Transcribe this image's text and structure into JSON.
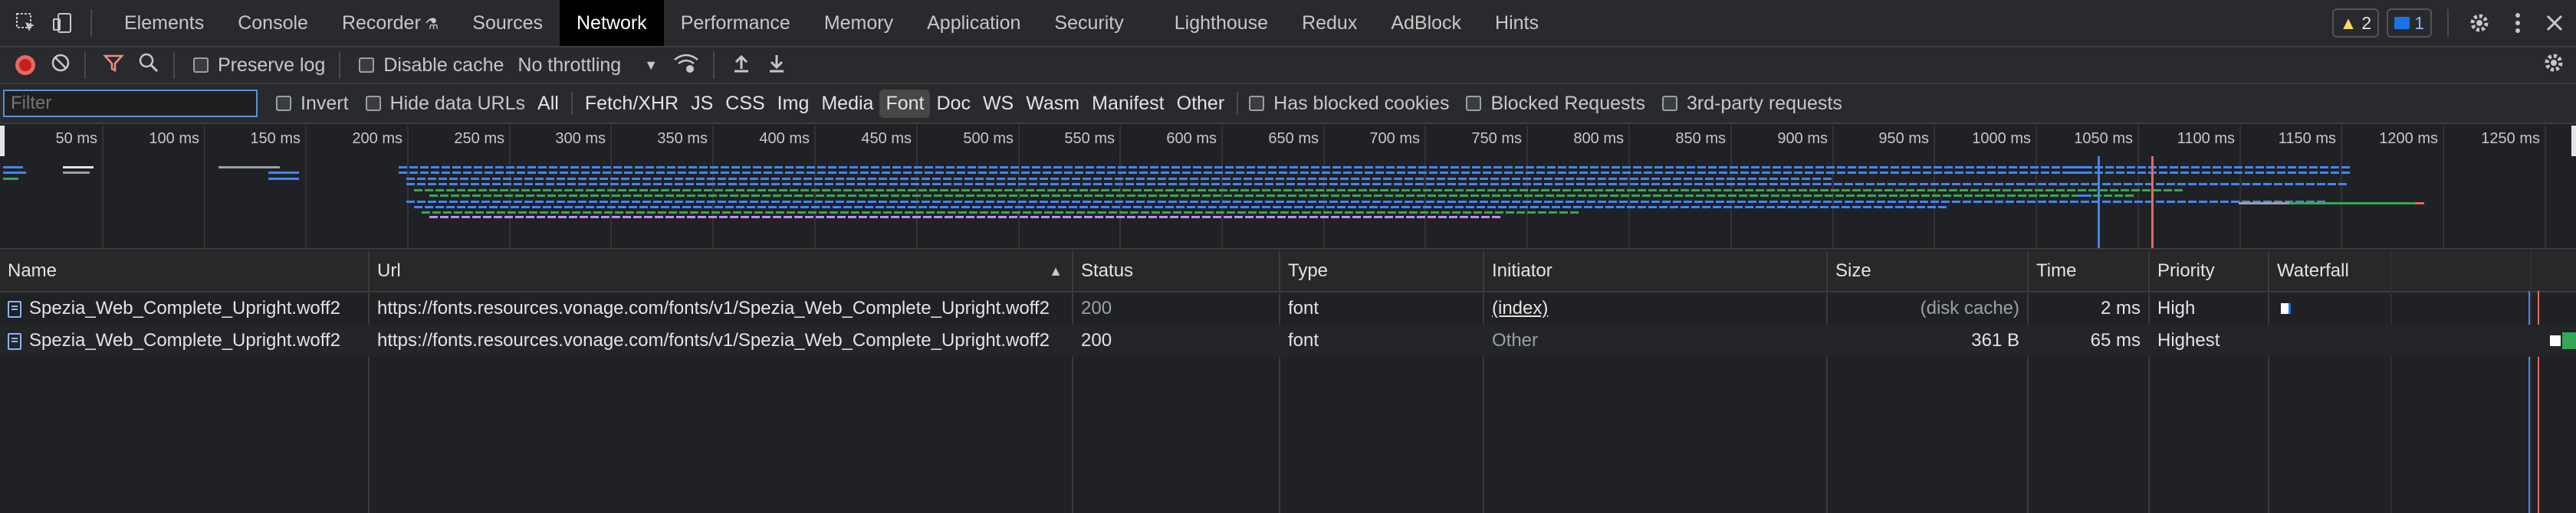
{
  "tabs": [
    "Elements",
    "Console",
    "Recorder",
    "Sources",
    "Network",
    "Performance",
    "Memory",
    "Application",
    "Security",
    "Lighthouse",
    "Redux",
    "AdBlock",
    "Hints"
  ],
  "active_tab": "Network",
  "badges": {
    "warnings": "2",
    "messages": "1"
  },
  "toolbar": {
    "preserve_log": "Preserve log",
    "disable_cache": "Disable cache",
    "throttling": "No throttling"
  },
  "filter": {
    "placeholder": "Filter",
    "invert": "Invert",
    "hide_data_urls": "Hide data URLs",
    "types": [
      "All",
      "Fetch/XHR",
      "JS",
      "CSS",
      "Img",
      "Media",
      "Font",
      "Doc",
      "WS",
      "Wasm",
      "Manifest",
      "Other"
    ],
    "active_type": "Font",
    "has_blocked_cookies": "Has blocked cookies",
    "blocked_requests": "Blocked Requests",
    "third_party": "3rd-party requests"
  },
  "overview_ticks": [
    "50 ms",
    "100 ms",
    "150 ms",
    "200 ms",
    "250 ms",
    "300 ms",
    "350 ms",
    "400 ms",
    "450 ms",
    "500 ms",
    "550 ms",
    "600 ms",
    "650 ms",
    "700 ms",
    "750 ms",
    "800 ms",
    "850 ms",
    "900 ms",
    "950 ms",
    "1000 ms",
    "1050 ms",
    "1100 ms",
    "1150 ms",
    "1200 ms",
    "1250 ms"
  ],
  "columns": [
    "Name",
    "Url",
    "Status",
    "Type",
    "Initiator",
    "Size",
    "Time",
    "Priority",
    "Waterfall"
  ],
  "rows": [
    {
      "name": "Spezia_Web_Complete_Upright.woff2",
      "url": "https://fonts.resources.vonage.com/fonts/v1/Spezia_Web_Complete_Upright.woff2",
      "status": "200",
      "type": "font",
      "initiator": "(index)",
      "size": "(disk cache)",
      "time": "2 ms",
      "priority": "High"
    },
    {
      "name": "Spezia_Web_Complete_Upright.woff2",
      "url": "https://fonts.resources.vonage.com/fonts/v1/Spezia_Web_Complete_Upright.woff2",
      "status": "200",
      "type": "font",
      "initiator": "Other",
      "size": "361 B",
      "time": "65 ms",
      "priority": "Highest"
    }
  ],
  "colors": {
    "accent": "#8ab4f8",
    "record": "#e46962",
    "filter_icon": "#f28b82"
  }
}
